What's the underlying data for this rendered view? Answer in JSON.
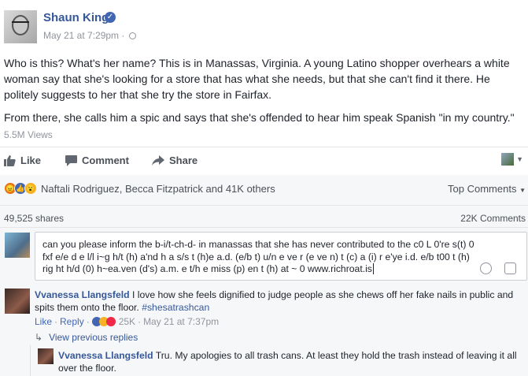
{
  "post": {
    "author": "Shaun King",
    "timestamp": "May 21 at 7:29pm",
    "separator": "·",
    "paragraph1": "Who is this? What's her name? This is in Manassas, Virginia. A young Latino shopper overhears a white woman say that she's looking for a store that has what she needs, but that she can't find it there. He politely suggests to her that she try the store in Fairfax.",
    "paragraph2": "From there, she calls him a spic and says that she's offended to hear him speak Spanish \"in my country.\"",
    "views": "5.5M Views"
  },
  "actions": {
    "like": "Like",
    "comment": "Comment",
    "share": "Share"
  },
  "reactions": {
    "names": "Naftali Rodriguez, Becca Fitzpatrick and 41K others",
    "top_comments": "Top Comments",
    "shares": "49,525 shares",
    "comments_count": "22K Comments"
  },
  "comment_box": {
    "value": "can you please inform the b-i/t-ch-d- in manassas that she has never contributed to the c0 L 0're s(t) 0 fxf e/e d e l/l i~g h/t (h) a'nd h a s/s t (h)e a.d. (e/b t) u/n e ve r (e ve n) t (c) a (i) r e'ye i.d. e/b t00 t (h) rig ht h/d (0) h~ea.ven (d's) a.m. e t/h e miss (p) en t (h) at ~ 0 www.richroat.is"
  },
  "comments": [
    {
      "name": "Vvanessa Llangsfeld",
      "text": "I love how she feels dignified to judge people as she chews off her fake nails in public and spits them onto the floor.",
      "hashtag": "#shesatrashcan",
      "like": "Like",
      "reply": "Reply",
      "reaction_count": "25K",
      "time": "May 21 at 7:37pm",
      "dot": "·"
    }
  ],
  "view_previous_replies": "View previous replies",
  "reply": {
    "name": "Vvanessa Llangsfeld",
    "text": "Tru. My apologies to all trash cans. At least they hold the trash instead of leaving it all over the floor."
  },
  "colors": {
    "link": "#365899",
    "meta": "#90949c",
    "background_gray": "#f6f7f9"
  }
}
